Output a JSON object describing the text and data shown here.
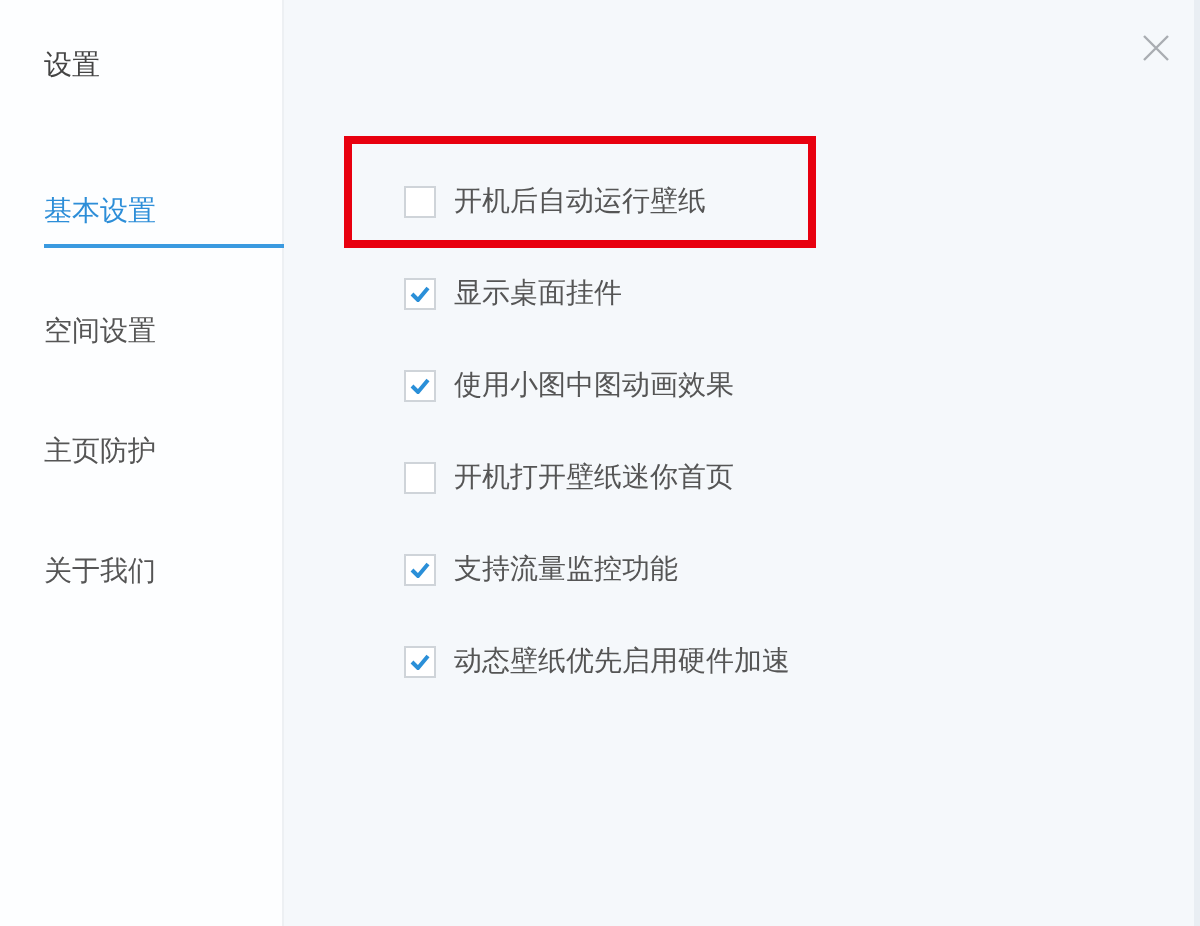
{
  "sidebar": {
    "title": "设置",
    "items": [
      {
        "label": "基本设置",
        "selected": true
      },
      {
        "label": "空间设置",
        "selected": false
      },
      {
        "label": "主页防护",
        "selected": false
      },
      {
        "label": "关于我们",
        "selected": false
      }
    ]
  },
  "options": [
    {
      "label": "开机后自动运行壁纸",
      "checked": false,
      "highlighted": true
    },
    {
      "label": "显示桌面挂件",
      "checked": true,
      "highlighted": false
    },
    {
      "label": "使用小图中图动画效果",
      "checked": true,
      "highlighted": false
    },
    {
      "label": "开机打开壁纸迷你首页",
      "checked": false,
      "highlighted": false
    },
    {
      "label": "支持流量监控功能",
      "checked": true,
      "highlighted": false
    },
    {
      "label": "动态壁纸优先启用硬件加速",
      "checked": true,
      "highlighted": false
    }
  ]
}
